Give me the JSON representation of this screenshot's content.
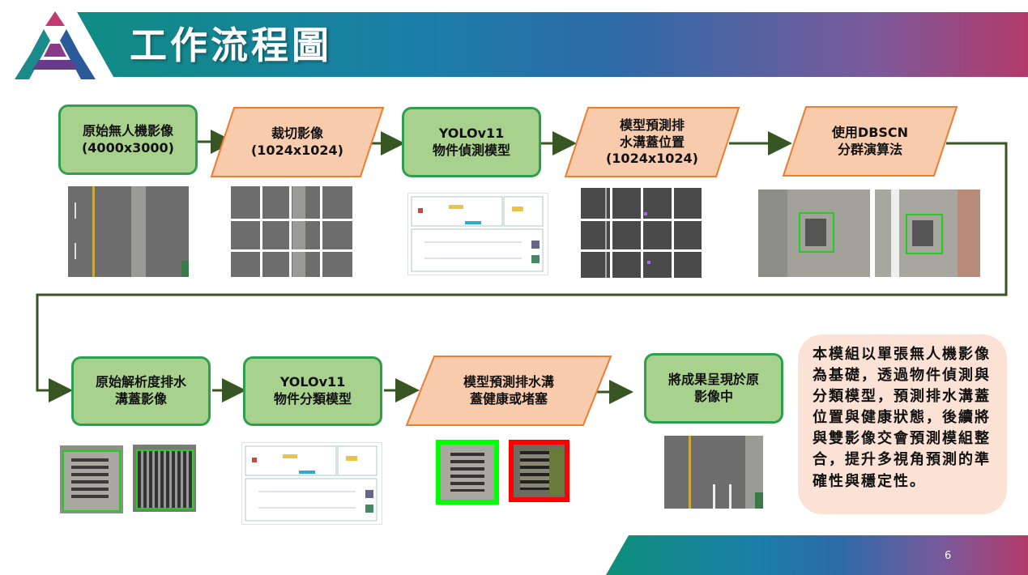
{
  "title": "工作流程圖",
  "row1": {
    "step1": "原始無人機影像\n(4000x3000)",
    "step2": "裁切影像\n(1024x1024)",
    "step3": "YOLOv11\n物件偵測模型",
    "step4": "模型預測排\n水溝蓋位置\n(1024x1024)",
    "step5": "使用DBSCN\n分群演算法"
  },
  "row2": {
    "step6": "原始解析度排水\n溝蓋影像",
    "step7": "YOLOv11\n物件分類模型",
    "step8": "模型預測排水溝\n蓋健康或堵塞",
    "step9": "將成果呈現於原\n影像中"
  },
  "note": "本模組以單張無人機影像為基礎，透過物件偵測與分類模型，預測排水溝蓋位置與健康狀態，後續將與雙影像交會預測模組整合，提升多視角預測的準確性與穩定性。",
  "page_number": "6",
  "colors": {
    "process_fill": "#a9d18e",
    "process_border": "#2e9e4f",
    "io_fill": "#f8cbad",
    "io_border": "#ed7d31",
    "arrow": "#375623",
    "healthy": "#00ff00",
    "blocked": "#ff0000"
  },
  "icons": [
    "logo-icon",
    "arrow-icon"
  ]
}
